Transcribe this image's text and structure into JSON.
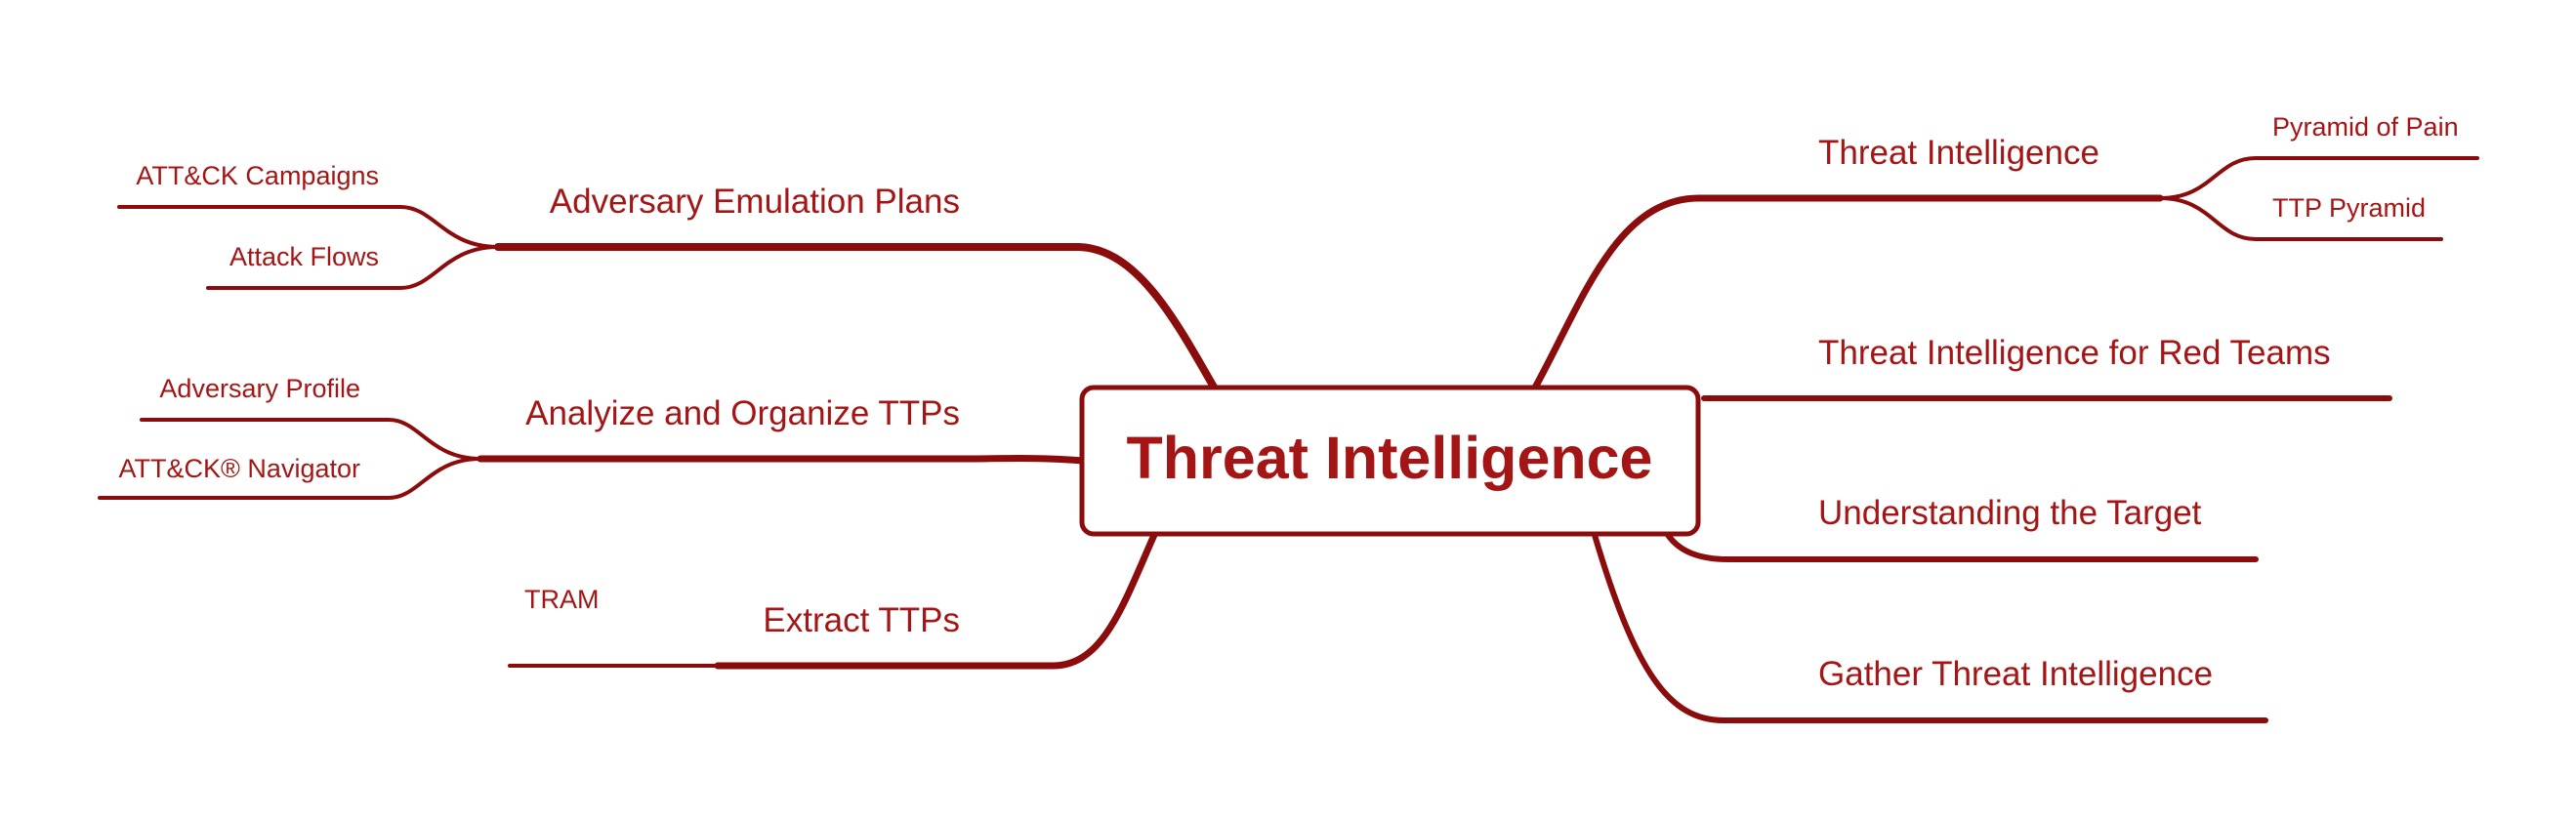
{
  "colors": {
    "accent": "#8b0c0c",
    "text": "#a41616",
    "background": "#ffffff"
  },
  "central": {
    "label": "Threat Intelligence"
  },
  "left_branches": [
    {
      "label": "Adversary Emulation Plans",
      "children": [
        "ATT&CK Campaigns",
        "Attack Flows"
      ]
    },
    {
      "label": "Analyize and Organize TTPs",
      "children": [
        "Adversary Profile",
        "ATT&CK® Navigator"
      ]
    },
    {
      "label": "Extract TTPs",
      "children": [
        "TRAM"
      ]
    }
  ],
  "right_branches": [
    {
      "label": "Threat Intelligence",
      "children": [
        "Pyramid of Pain",
        "TTP Pyramid"
      ]
    },
    {
      "label": "Threat Intelligence for Red Teams",
      "children": []
    },
    {
      "label": "Understanding the Target",
      "children": []
    },
    {
      "label": "Gather Threat Intelligence",
      "children": []
    }
  ]
}
